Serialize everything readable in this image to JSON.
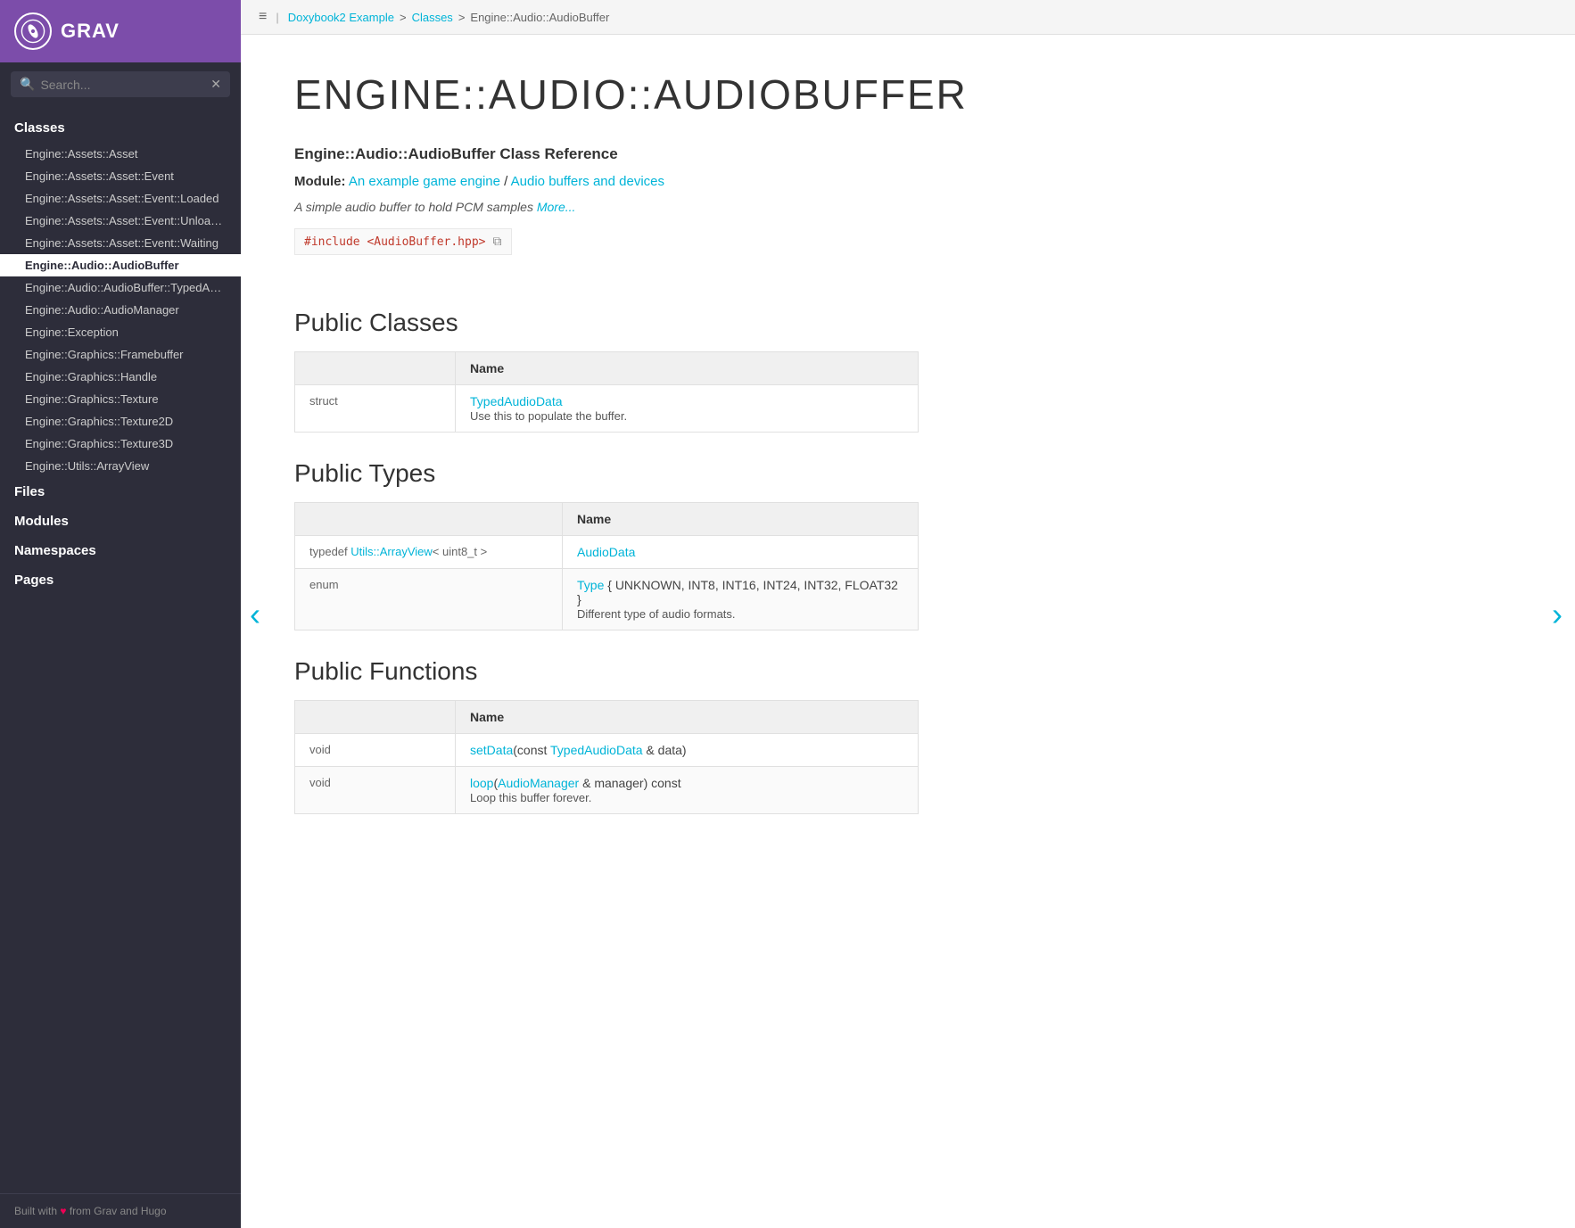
{
  "sidebar": {
    "logo_alt": "Grav logo",
    "title": "GRAV",
    "search": {
      "placeholder": "Search...",
      "value": ""
    },
    "sections": [
      {
        "label": "Classes",
        "items": [
          "Engine::Assets::Asset",
          "Engine::Assets::Asset::Event",
          "Engine::Assets::Asset::Event::Loaded",
          "Engine::Assets::Asset::Event::Unloaded",
          "Engine::Assets::Asset::Event::Waiting",
          "Engine::Audio::AudioBuffer",
          "Engine::Audio::AudioBuffer::TypedAudio",
          "Engine::Audio::AudioManager",
          "Engine::Exception",
          "Engine::Graphics::Framebuffer",
          "Engine::Graphics::Handle",
          "Engine::Graphics::Texture",
          "Engine::Graphics::Texture2D",
          "Engine::Graphics::Texture3D",
          "Engine::Utils::ArrayView"
        ]
      },
      {
        "label": "Files",
        "items": []
      },
      {
        "label": "Modules",
        "items": []
      },
      {
        "label": "Namespaces",
        "items": []
      },
      {
        "label": "Pages",
        "items": []
      }
    ],
    "active_item": "Engine::Audio::AudioBuffer",
    "footer": "Built with ♥ from Grav and Hugo"
  },
  "breadcrumb": {
    "icon": "≡",
    "links": [
      {
        "label": "Doxybook2 Example",
        "href": "#"
      },
      {
        "label": "Classes",
        "href": "#"
      }
    ],
    "current": "Engine::Audio::AudioBuffer"
  },
  "page": {
    "title": "ENGINE::AUDIO::AUDIOBUFFER",
    "class_reference": "Engine::Audio::AudioBuffer Class Reference",
    "module_label": "Module:",
    "module_link1_text": "An example game engine",
    "module_link2_text": "Audio buffers and devices",
    "description": "A simple audio buffer to hold PCM samples",
    "more_link": "More...",
    "include": "#include <AudioBuffer.hpp>",
    "sections": [
      {
        "title": "Public Classes",
        "columns": [
          "",
          "Name"
        ],
        "rows": [
          {
            "col1": "struct",
            "col2_link": "TypedAudioData",
            "col2_desc": "Use this to populate the buffer."
          }
        ]
      },
      {
        "title": "Public Types",
        "columns": [
          "",
          "Name"
        ],
        "rows": [
          {
            "col1": "typedef Utils::ArrayView< uint8_t >",
            "col1_link": "Utils::ArrayView",
            "col2_link": "AudioData",
            "col2_desc": ""
          },
          {
            "col1": "enum",
            "col2_link": "Type",
            "col2_extra": "{ UNKNOWN, INT8, INT16, INT24, INT32, FLOAT32 }",
            "col2_desc": "Different type of audio formats."
          }
        ]
      },
      {
        "title": "Public Functions",
        "columns": [
          "",
          "Name"
        ],
        "rows": [
          {
            "col1": "void",
            "col2_link": "setData",
            "col2_extra": "(const TypedAudioData & data)",
            "col2_link2": "TypedAudioData",
            "col2_desc": ""
          },
          {
            "col1": "void",
            "col2_link": "loop",
            "col2_extra": "(AudioManager & manager) const",
            "col2_link2": "AudioManager",
            "col2_desc": "Loop this buffer forever."
          }
        ]
      }
    ]
  }
}
